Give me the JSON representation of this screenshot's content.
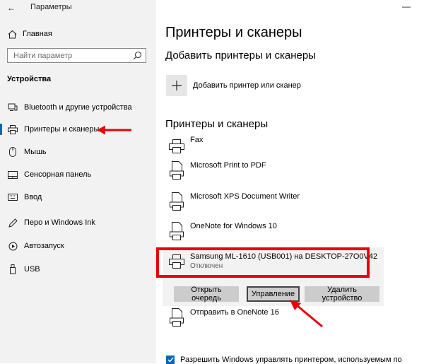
{
  "window": {
    "title": "Параметры",
    "back_glyph": "←",
    "minimize_glyph": "—",
    "close_glyph": "✕"
  },
  "sidebar": {
    "home_label": "Главная",
    "search_placeholder": "Найти параметр",
    "section_title": "Устройства",
    "items": [
      {
        "label": "Bluetooth и другие устройства",
        "icon": "bluetooth-devices-icon"
      },
      {
        "label": "Принтеры и сканеры",
        "icon": "printer-icon",
        "active": true
      },
      {
        "label": "Мышь",
        "icon": "mouse-icon"
      },
      {
        "label": "Сенсорная панель",
        "icon": "touchpad-icon"
      },
      {
        "label": "Ввод",
        "icon": "keyboard-icon"
      },
      {
        "label": "Перо и Windows Ink",
        "icon": "pen-icon"
      },
      {
        "label": "Автозапуск",
        "icon": "autoplay-icon"
      },
      {
        "label": "USB",
        "icon": "usb-icon"
      }
    ]
  },
  "main": {
    "page_title": "Принтеры и сканеры",
    "add_section_title": "Добавить принтеры и сканеры",
    "add_button_label": "Добавить принтер или сканер",
    "list_section_title": "Принтеры и сканеры",
    "printers": [
      {
        "name": "Fax"
      },
      {
        "name": "Microsoft Print to PDF"
      },
      {
        "name": "Microsoft XPS Document Writer"
      },
      {
        "name": "OneNote for Windows 10"
      }
    ],
    "selected_printer": {
      "name": "Samsung ML-1610 (USB001) на DESKTOP-27O0V42",
      "status": "Отключен"
    },
    "actions": {
      "open_queue": "Открыть очередь",
      "manage": "Управление",
      "remove": "Удалить устройство"
    },
    "after_printers": [
      {
        "name": "Отправить в OneNote 16"
      }
    ],
    "checkbox_label": "Разрешить Windows управлять принтером, используемым по"
  },
  "colors": {
    "annotation_red": "#e8000b",
    "accent_blue": "#0067c0",
    "sidebar_bg": "#f2f2f2"
  }
}
